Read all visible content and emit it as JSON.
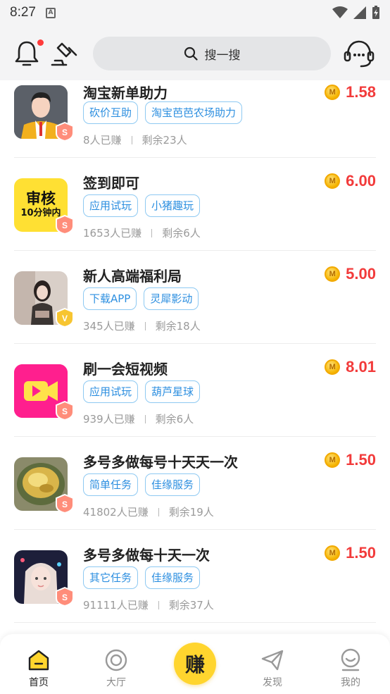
{
  "status_bar": {
    "time": "8:27",
    "notification_icon": "A"
  },
  "header": {
    "search_placeholder": "搜一搜"
  },
  "colors": {
    "accent": "#ffd52e",
    "price": "#f23b3b",
    "tag_text": "#2d8fe0",
    "tag_border": "#8ec9f2"
  },
  "tasks": [
    {
      "title": "淘宝新单助力",
      "reward": "1.58",
      "coin_symbol": "M",
      "tags": [
        "砍价互助",
        "淘宝芭芭农场助力"
      ],
      "earned": "8人已赚",
      "remaining": "剩余23人",
      "badge": "S",
      "thumb": "avatar-man"
    },
    {
      "title": "签到即可",
      "reward": "6.00",
      "coin_symbol": "M",
      "tags": [
        "应用试玩",
        "小猪趣玩"
      ],
      "earned": "1653人已赚",
      "remaining": "剩余6人",
      "badge": "S",
      "thumb": "review-card",
      "thumb_text_1": "审核",
      "thumb_text_2": "10分钟内"
    },
    {
      "title": "新人高端福利局",
      "reward": "5.00",
      "coin_symbol": "M",
      "tags": [
        "下载APP",
        "灵犀影动"
      ],
      "earned": "345人已赚",
      "remaining": "剩余18人",
      "badge": "V",
      "thumb": "photo-girl"
    },
    {
      "title": "刷一会短视频",
      "reward": "8.01",
      "coin_symbol": "M",
      "tags": [
        "应用试玩",
        "葫芦星球"
      ],
      "earned": "939人已赚",
      "remaining": "剩余6人",
      "badge": "S",
      "thumb": "video-app"
    },
    {
      "title": "多号多做每号十天天一次",
      "reward": "1.50",
      "coin_symbol": "M",
      "tags": [
        "简单任务",
        "佳缘服务"
      ],
      "earned": "41802人已赚",
      "remaining": "剩余19人",
      "badge": "S",
      "thumb": "gold-photo"
    },
    {
      "title": "多号多做每十天一次",
      "reward": "1.50",
      "coin_symbol": "M",
      "tags": [
        "其它任务",
        "佳缘服务"
      ],
      "earned": "91111人已赚",
      "remaining": "剩余37人",
      "badge": "S",
      "thumb": "anime-girl"
    }
  ],
  "bottom_nav": {
    "home": "首页",
    "hall": "大厅",
    "earn": "赚",
    "discover": "发现",
    "mine": "我的"
  }
}
